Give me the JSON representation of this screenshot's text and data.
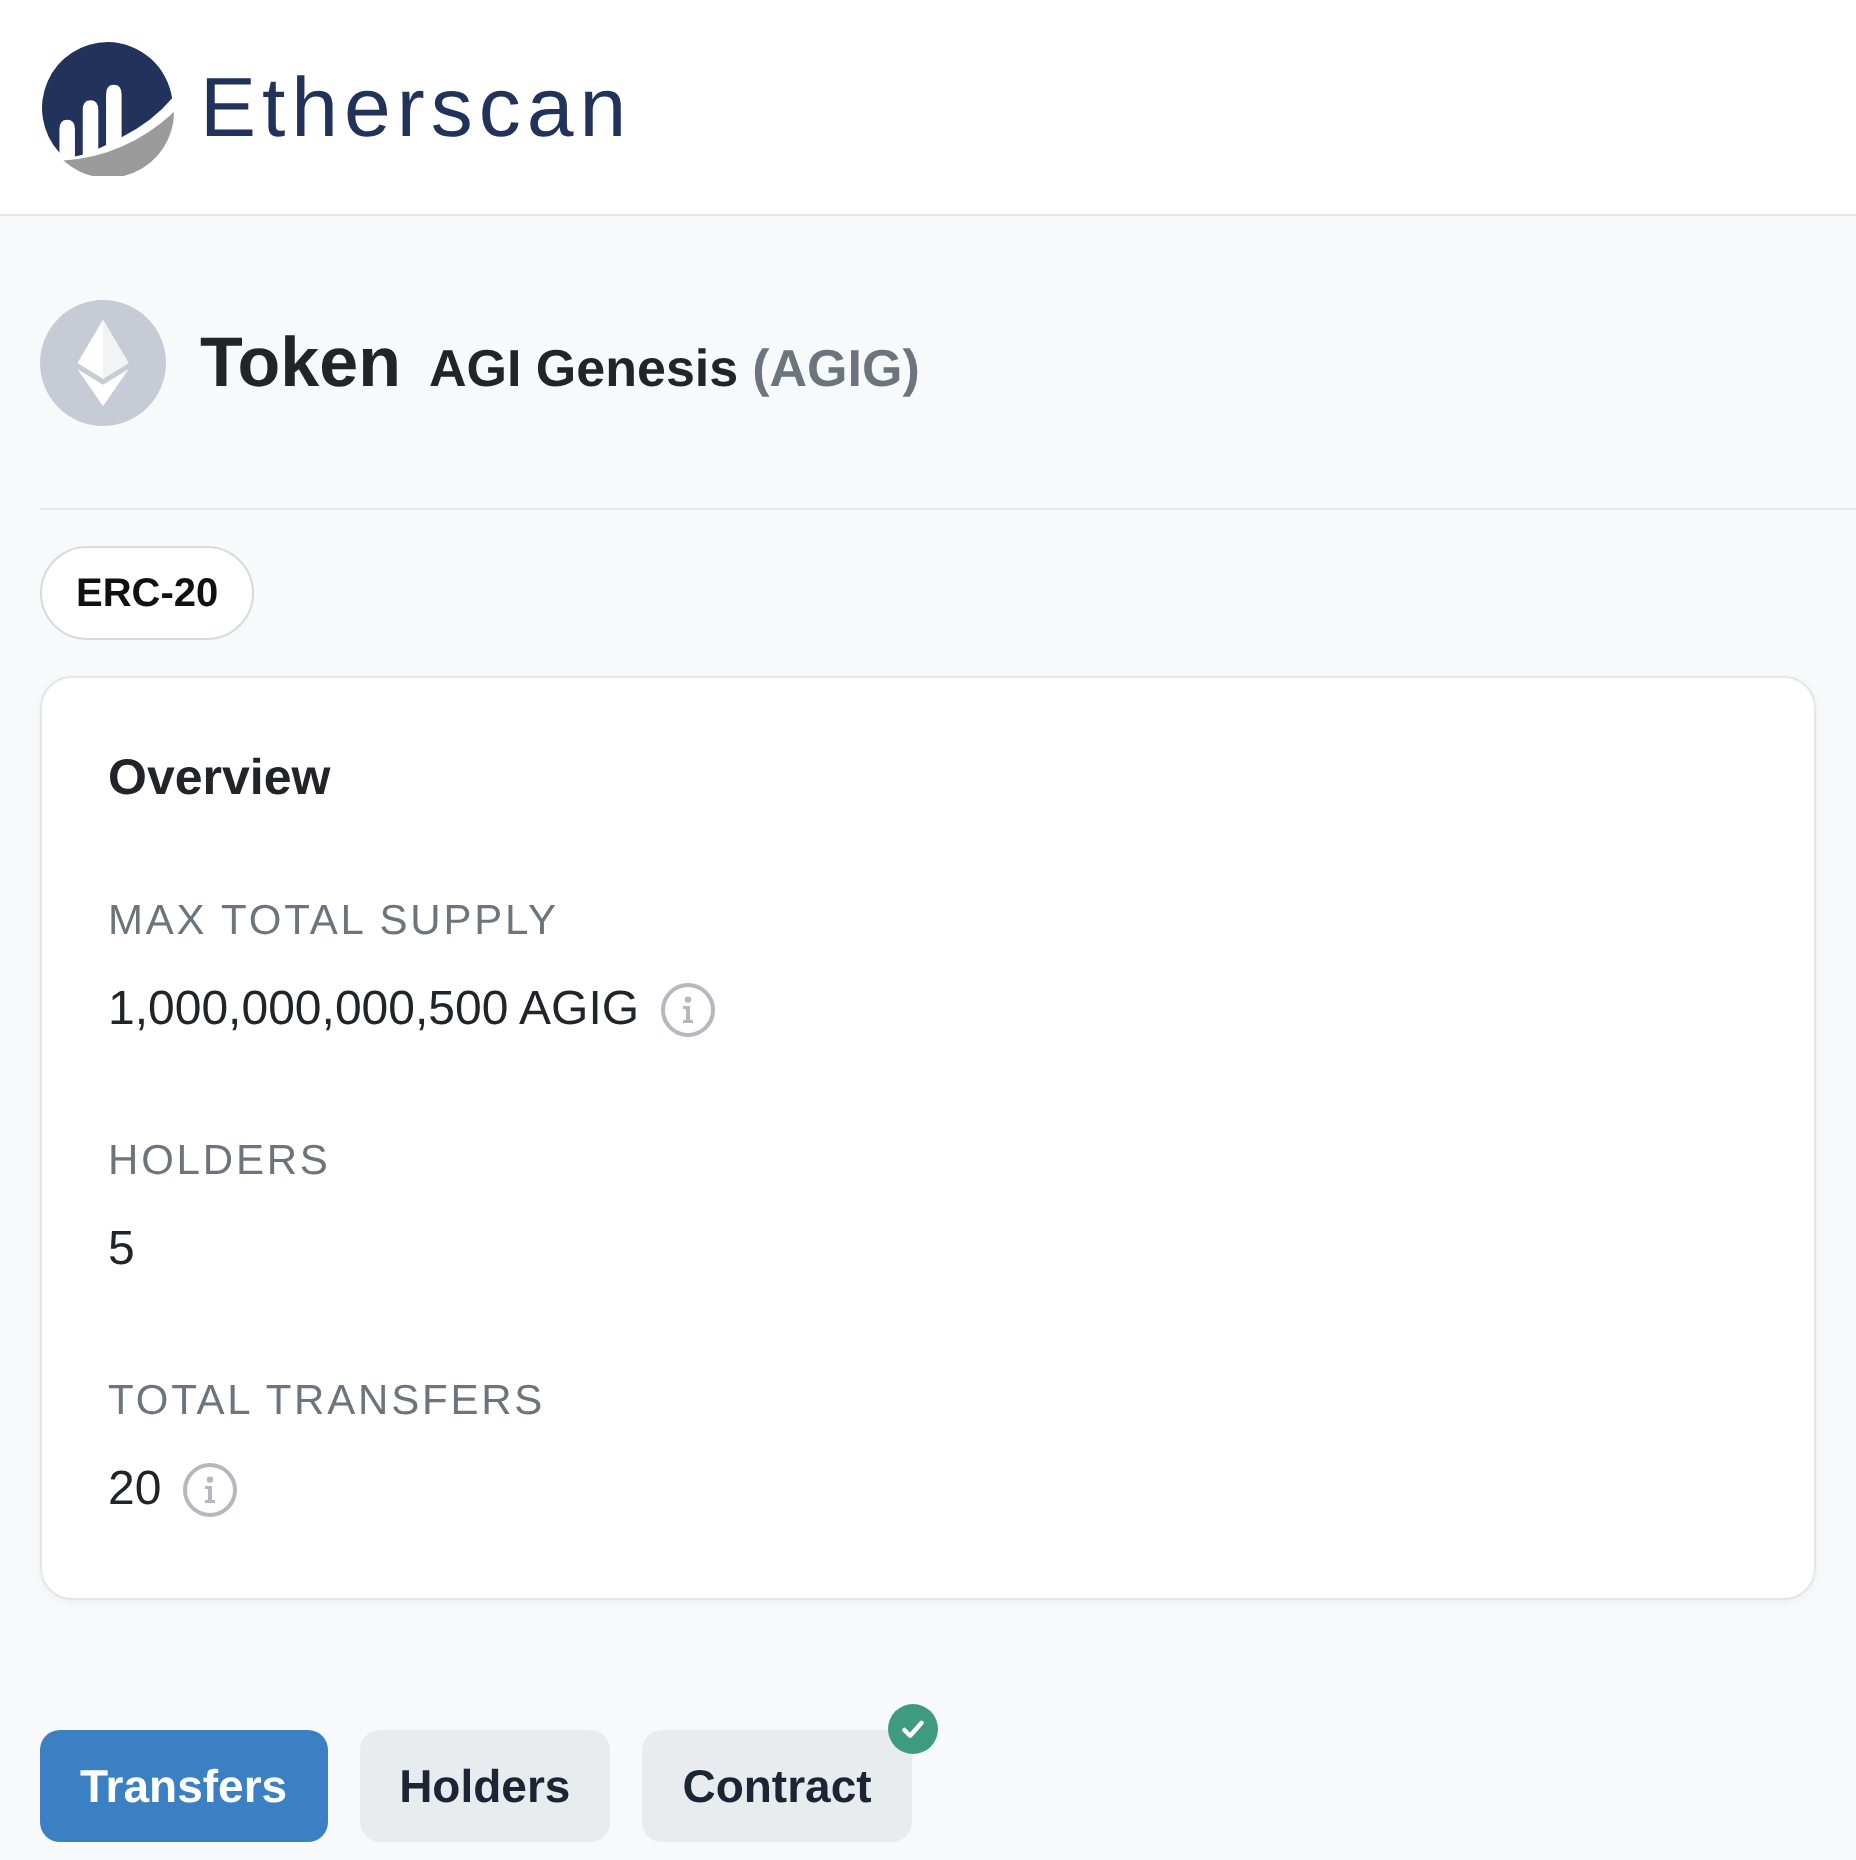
{
  "header": {
    "logo_text": "Etherscan"
  },
  "token": {
    "heading": "Token",
    "name": "AGI Genesis",
    "symbol": "(AGIG)"
  },
  "badge": "ERC-20",
  "overview": {
    "title": "Overview",
    "fields": [
      {
        "label": "MAX TOTAL SUPPLY",
        "value": "1,000,000,000,500 AGIG",
        "info": true
      },
      {
        "label": "HOLDERS",
        "value": "5",
        "info": false
      },
      {
        "label": "TOTAL TRANSFERS",
        "value": "20",
        "info": true
      }
    ]
  },
  "tabs": [
    {
      "label": "Transfers",
      "selected": true,
      "verified": false
    },
    {
      "label": "Holders",
      "selected": false,
      "verified": false
    },
    {
      "label": "Contract",
      "selected": false,
      "verified": true
    }
  ]
}
